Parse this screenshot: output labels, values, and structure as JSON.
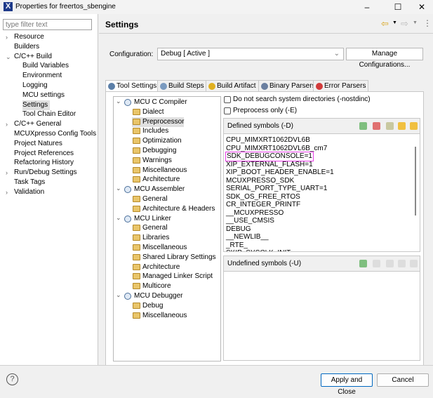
{
  "window": {
    "title": "Properties for freertos_sbengine",
    "icon": "X",
    "minimize": "–",
    "maximize": "☐",
    "close": "✕"
  },
  "filter": {
    "placeholder": "type filter text"
  },
  "nav": [
    {
      "label": "Resource",
      "indent": 1,
      "chev": "›"
    },
    {
      "label": "Builders",
      "indent": 1
    },
    {
      "label": "C/C++ Build",
      "indent": 1,
      "chev": "⌄"
    },
    {
      "label": "Build Variables",
      "indent": 2
    },
    {
      "label": "Environment",
      "indent": 2
    },
    {
      "label": "Logging",
      "indent": 2
    },
    {
      "label": "MCU settings",
      "indent": 2
    },
    {
      "label": "Settings",
      "indent": 2,
      "selected": true
    },
    {
      "label": "Tool Chain Editor",
      "indent": 2
    },
    {
      "label": "C/C++ General",
      "indent": 1,
      "chev": "›"
    },
    {
      "label": "MCUXpresso Config Tools",
      "indent": 1
    },
    {
      "label": "Project Natures",
      "indent": 1
    },
    {
      "label": "Project References",
      "indent": 1
    },
    {
      "label": "Refactoring History",
      "indent": 1
    },
    {
      "label": "Run/Debug Settings",
      "indent": 1,
      "chev": "›"
    },
    {
      "label": "Task Tags",
      "indent": 1
    },
    {
      "label": "Validation",
      "indent": 1,
      "chev": "›"
    }
  ],
  "header": {
    "title": "Settings",
    "back": "⇦",
    "forward": "⇨",
    "menu": "⋮"
  },
  "config": {
    "label": "Configuration:",
    "value": "Debug  [ Active ]",
    "manage": "Manage Configurations..."
  },
  "tabs": [
    {
      "label": "Tool Settings",
      "color": "#5b7fa8",
      "active": true
    },
    {
      "label": "Build Steps",
      "color": "#7a9abf"
    },
    {
      "label": "Build Artifact",
      "color": "#e0b020"
    },
    {
      "label": "Binary Parsers",
      "color": "#6a7fa0"
    },
    {
      "label": "Error Parsers",
      "color": "#d23b3b"
    }
  ],
  "tree": [
    {
      "label": "MCU C Compiler",
      "level": 0,
      "type": "gear"
    },
    {
      "label": "Dialect",
      "level": 1
    },
    {
      "label": "Preprocessor",
      "level": 1,
      "selected": true
    },
    {
      "label": "Includes",
      "level": 1
    },
    {
      "label": "Optimization",
      "level": 1
    },
    {
      "label": "Debugging",
      "level": 1
    },
    {
      "label": "Warnings",
      "level": 1
    },
    {
      "label": "Miscellaneous",
      "level": 1
    },
    {
      "label": "Architecture",
      "level": 1
    },
    {
      "label": "MCU Assembler",
      "level": 0,
      "type": "gear"
    },
    {
      "label": "General",
      "level": 1
    },
    {
      "label": "Architecture & Headers",
      "level": 1
    },
    {
      "label": "MCU Linker",
      "level": 0,
      "type": "gear"
    },
    {
      "label": "General",
      "level": 1
    },
    {
      "label": "Libraries",
      "level": 1
    },
    {
      "label": "Miscellaneous",
      "level": 1
    },
    {
      "label": "Shared Library Settings",
      "level": 1
    },
    {
      "label": "Architecture",
      "level": 1
    },
    {
      "label": "Managed Linker Script",
      "level": 1
    },
    {
      "label": "Multicore",
      "level": 1
    },
    {
      "label": "MCU Debugger",
      "level": 0,
      "type": "gear"
    },
    {
      "label": "Debug",
      "level": 1
    },
    {
      "label": "Miscellaneous",
      "level": 1
    }
  ],
  "options": {
    "nostdinc": "Do not search system directories (-nostdinc)",
    "preprocess_only": "Preprocess only (-E)"
  },
  "defined": {
    "title": "Defined symbols (-D)",
    "highlight_color": "#e83ee8",
    "symbols": [
      "CPU_MIMXRT1062DVL6B",
      "CPU_MIMXRT1062DVL6B_cm7",
      "SDK_DEBUGCONSOLE=1",
      "XIP_EXTERNAL_FLASH=1",
      "XIP_BOOT_HEADER_ENABLE=1",
      "MCUXPRESSO_SDK",
      "SERIAL_PORT_TYPE_UART=1",
      "SDK_OS_FREE_RTOS",
      "CR_INTEGER_PRINTF",
      "__MCUXPRESSO",
      "__USE_CMSIS",
      "DEBUG",
      "__NEWLIB__",
      "_RTE_",
      "SKIP_SYSCLK_INIT"
    ]
  },
  "undefined": {
    "title": "Undefined symbols (-U)"
  },
  "footer": {
    "help": "?",
    "apply": "Apply and Close",
    "cancel": "Cancel"
  }
}
